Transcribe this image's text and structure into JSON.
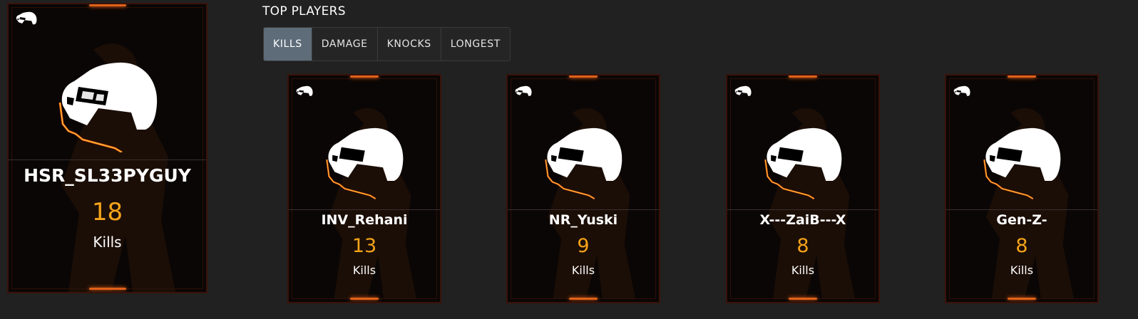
{
  "section_title": "TOP PLAYERS",
  "tabs": [
    {
      "label": "KILLS",
      "active": true
    },
    {
      "label": "DAMAGE",
      "active": false
    },
    {
      "label": "KNOCKS",
      "active": false
    },
    {
      "label": "LONGEST",
      "active": false
    }
  ],
  "colors": {
    "accent_value": "#f5a319",
    "active_tab": "#5d6c78",
    "glow": "#e0621a",
    "background": "#212121"
  },
  "featured_player": {
    "name": "HSR_SL33PYGUY",
    "value": "18",
    "unit": "Kills",
    "icon": "helmet-icon"
  },
  "players": [
    {
      "name": "INV_Rehani",
      "value": "13",
      "unit": "Kills",
      "icon": "helmet-icon"
    },
    {
      "name": "NR_Yuski",
      "value": "9",
      "unit": "Kills",
      "icon": "helmet-icon"
    },
    {
      "name": "X---ZaiB---X",
      "value": "8",
      "unit": "Kills",
      "icon": "helmet-icon"
    },
    {
      "name": "Gen-Z-",
      "value": "8",
      "unit": "Kills",
      "icon": "helmet-icon"
    }
  ]
}
